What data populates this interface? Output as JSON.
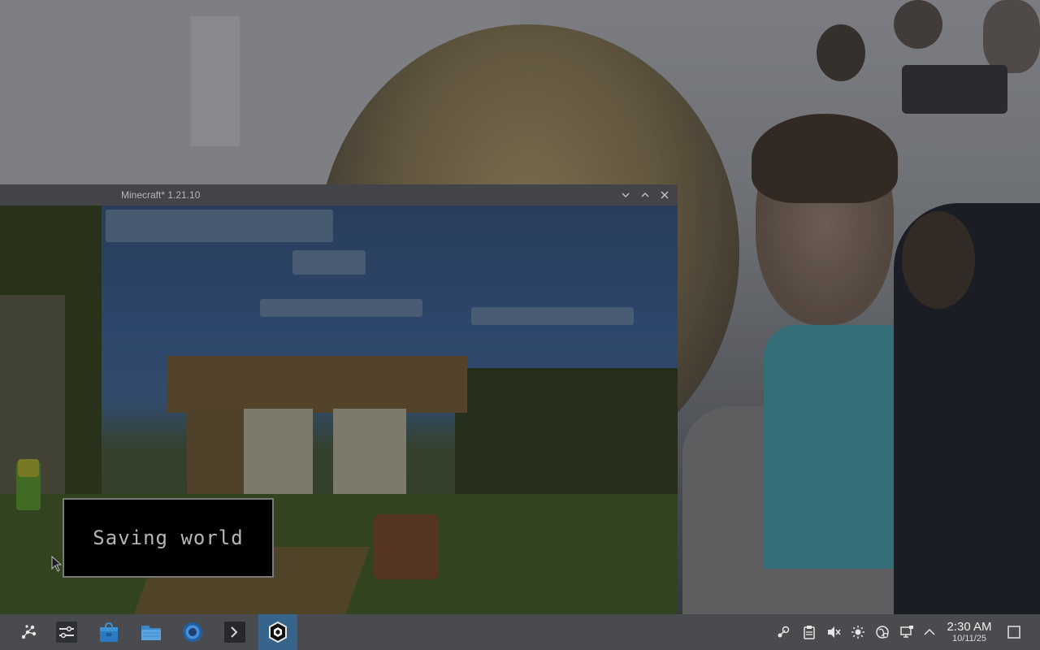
{
  "window": {
    "title": "Minecraft* 1.21.10",
    "controls": {
      "minimize_icon": "chevron-down-icon",
      "maximize_icon": "chevron-up-icon",
      "close_icon": "close-icon"
    }
  },
  "game": {
    "toast_text": "Saving world"
  },
  "taskbar": {
    "launcher_icon": "app-launcher-icon",
    "pinned_apps": [
      {
        "name": "system-settings-icon"
      },
      {
        "name": "store-icon"
      },
      {
        "name": "file-manager-icon"
      },
      {
        "name": "browser-icon"
      },
      {
        "name": "terminal-icon"
      },
      {
        "name": "minecraft-icon",
        "active": true
      }
    ],
    "active_color": "#36648a",
    "tray": [
      "steam-icon",
      "clipboard-icon",
      "volume-muted-icon",
      "brightness-icon",
      "network-icon",
      "display-icon",
      "chevron-up-icon"
    ],
    "clock": {
      "time": "2:30 AM",
      "date": "10/11/25"
    },
    "show_desktop_icon": "show-desktop-icon"
  }
}
